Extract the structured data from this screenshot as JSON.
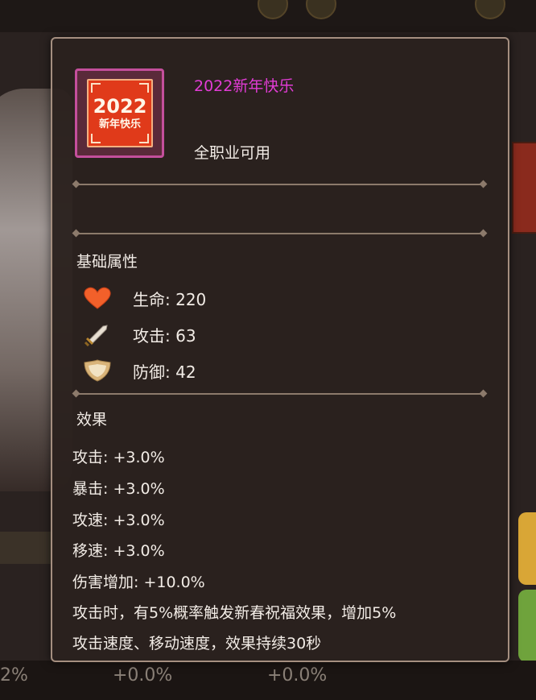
{
  "background": {
    "bottom_values": [
      "2%",
      "+0.0%",
      "+0.0%"
    ]
  },
  "item": {
    "icon_name": "new-year-2022-card-icon",
    "icon_year": "2022",
    "icon_text": "新年快乐",
    "name": "2022新年快乐",
    "name_color": "#e23cd6",
    "class_restriction": "全职业可用",
    "frame_color": "#c44f9c"
  },
  "base_stats": {
    "title": "基础属性",
    "items": [
      {
        "icon": "heart-icon",
        "text": "生命: 220"
      },
      {
        "icon": "sword-icon",
        "text": "攻击: 63"
      },
      {
        "icon": "shield-icon",
        "text": "防御: 42"
      }
    ]
  },
  "effects": {
    "title": "效果",
    "lines": [
      "攻击: +3.0%",
      "暴击: +3.0%",
      "攻速: +3.0%",
      "移速: +3.0%",
      "伤害增加: +10.0%",
      "攻击时，有5%概率触发新春祝福效果，增加5%",
      "攻击速度、移动速度，效果持续30秒"
    ]
  }
}
